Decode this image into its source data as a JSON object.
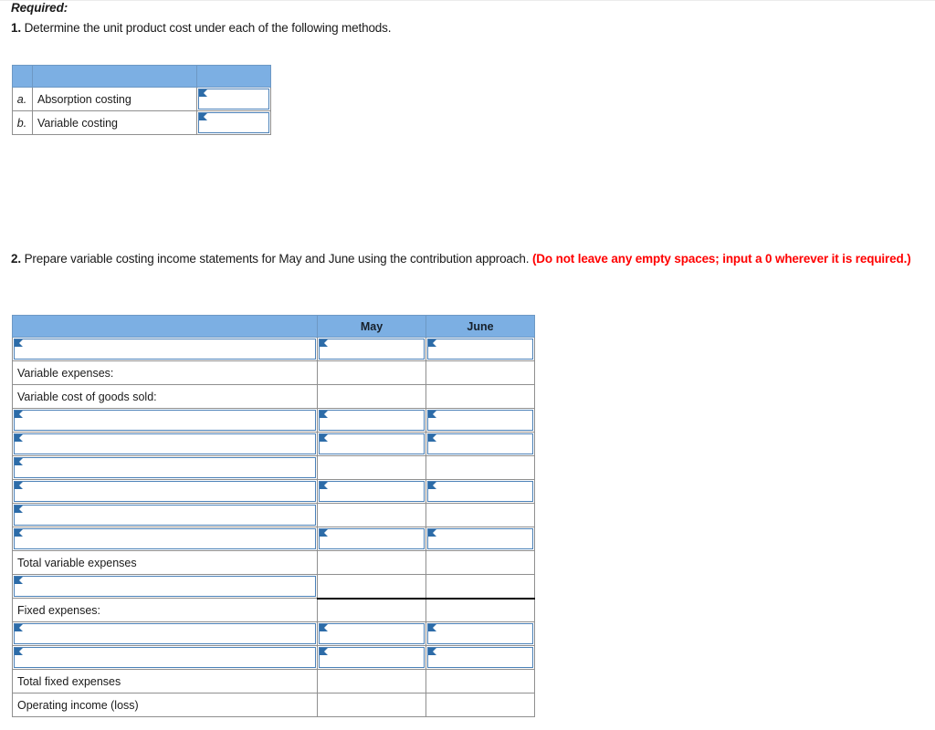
{
  "instructions": {
    "required_label": "Required:",
    "q1_number": "1.",
    "q1_text": " Determine the unit product cost under each of the following methods.",
    "q2_number": "2.",
    "q2_text": " Prepare variable costing income statements for May and June using the contribution approach. ",
    "q2_red": "(Do not leave any empty spaces; input a 0 wherever it is required.)"
  },
  "colors": {
    "header_blue": "#7cafe3",
    "input_border": "#4b81b8",
    "marker_blue": "#2d6ca8",
    "red": "#ff0000",
    "grid": "#8f8f8f"
  },
  "table1": {
    "header": {
      "letter": "",
      "label": "",
      "value": ""
    },
    "rows": [
      {
        "letter": "a.",
        "label": "Absorption costing",
        "value": "",
        "value_is_input": true
      },
      {
        "letter": "b.",
        "label": "Variable costing",
        "value": "",
        "value_is_input": true
      }
    ]
  },
  "table2": {
    "columns": [
      "",
      "May",
      "June"
    ],
    "rows": [
      {
        "label": "",
        "label_is_input": true,
        "may_is_input": true,
        "june_is_input": true,
        "may": "",
        "june": ""
      },
      {
        "label": "Variable expenses:",
        "label_is_input": false,
        "may_is_input": false,
        "june_is_input": false,
        "may": "",
        "june": ""
      },
      {
        "label": "Variable cost of goods sold:",
        "label_is_input": false,
        "may_is_input": false,
        "june_is_input": false,
        "may": "",
        "june": ""
      },
      {
        "label": "",
        "label_is_input": true,
        "may_is_input": true,
        "june_is_input": true,
        "may": "",
        "june": ""
      },
      {
        "label": "",
        "label_is_input": true,
        "may_is_input": true,
        "june_is_input": true,
        "may": "",
        "june": ""
      },
      {
        "label": "",
        "label_is_input": true,
        "may_is_input": false,
        "june_is_input": false,
        "may": "",
        "june": ""
      },
      {
        "label": "",
        "label_is_input": true,
        "may_is_input": true,
        "june_is_input": true,
        "may": "",
        "june": ""
      },
      {
        "label": "",
        "label_is_input": true,
        "may_is_input": false,
        "june_is_input": false,
        "may": "",
        "june": ""
      },
      {
        "label": "",
        "label_is_input": true,
        "may_is_input": true,
        "june_is_input": true,
        "may": "",
        "june": ""
      },
      {
        "label": "Total variable expenses",
        "label_is_input": false,
        "may_is_input": false,
        "june_is_input": false,
        "may": "",
        "june": ""
      },
      {
        "label": "",
        "label_is_input": true,
        "may_is_input": false,
        "june_is_input": false,
        "may": "",
        "june": "",
        "rule": true
      },
      {
        "label": "Fixed expenses:",
        "label_is_input": false,
        "may_is_input": false,
        "june_is_input": false,
        "may": "",
        "june": ""
      },
      {
        "label": "",
        "label_is_input": true,
        "may_is_input": true,
        "june_is_input": true,
        "may": "",
        "june": ""
      },
      {
        "label": "",
        "label_is_input": true,
        "may_is_input": true,
        "june_is_input": true,
        "may": "",
        "june": ""
      },
      {
        "label": "Total fixed expenses",
        "label_is_input": false,
        "may_is_input": false,
        "june_is_input": false,
        "may": "",
        "june": ""
      },
      {
        "label": "Operating income (loss)",
        "label_is_input": false,
        "may_is_input": false,
        "june_is_input": false,
        "may": "",
        "june": ""
      }
    ]
  }
}
